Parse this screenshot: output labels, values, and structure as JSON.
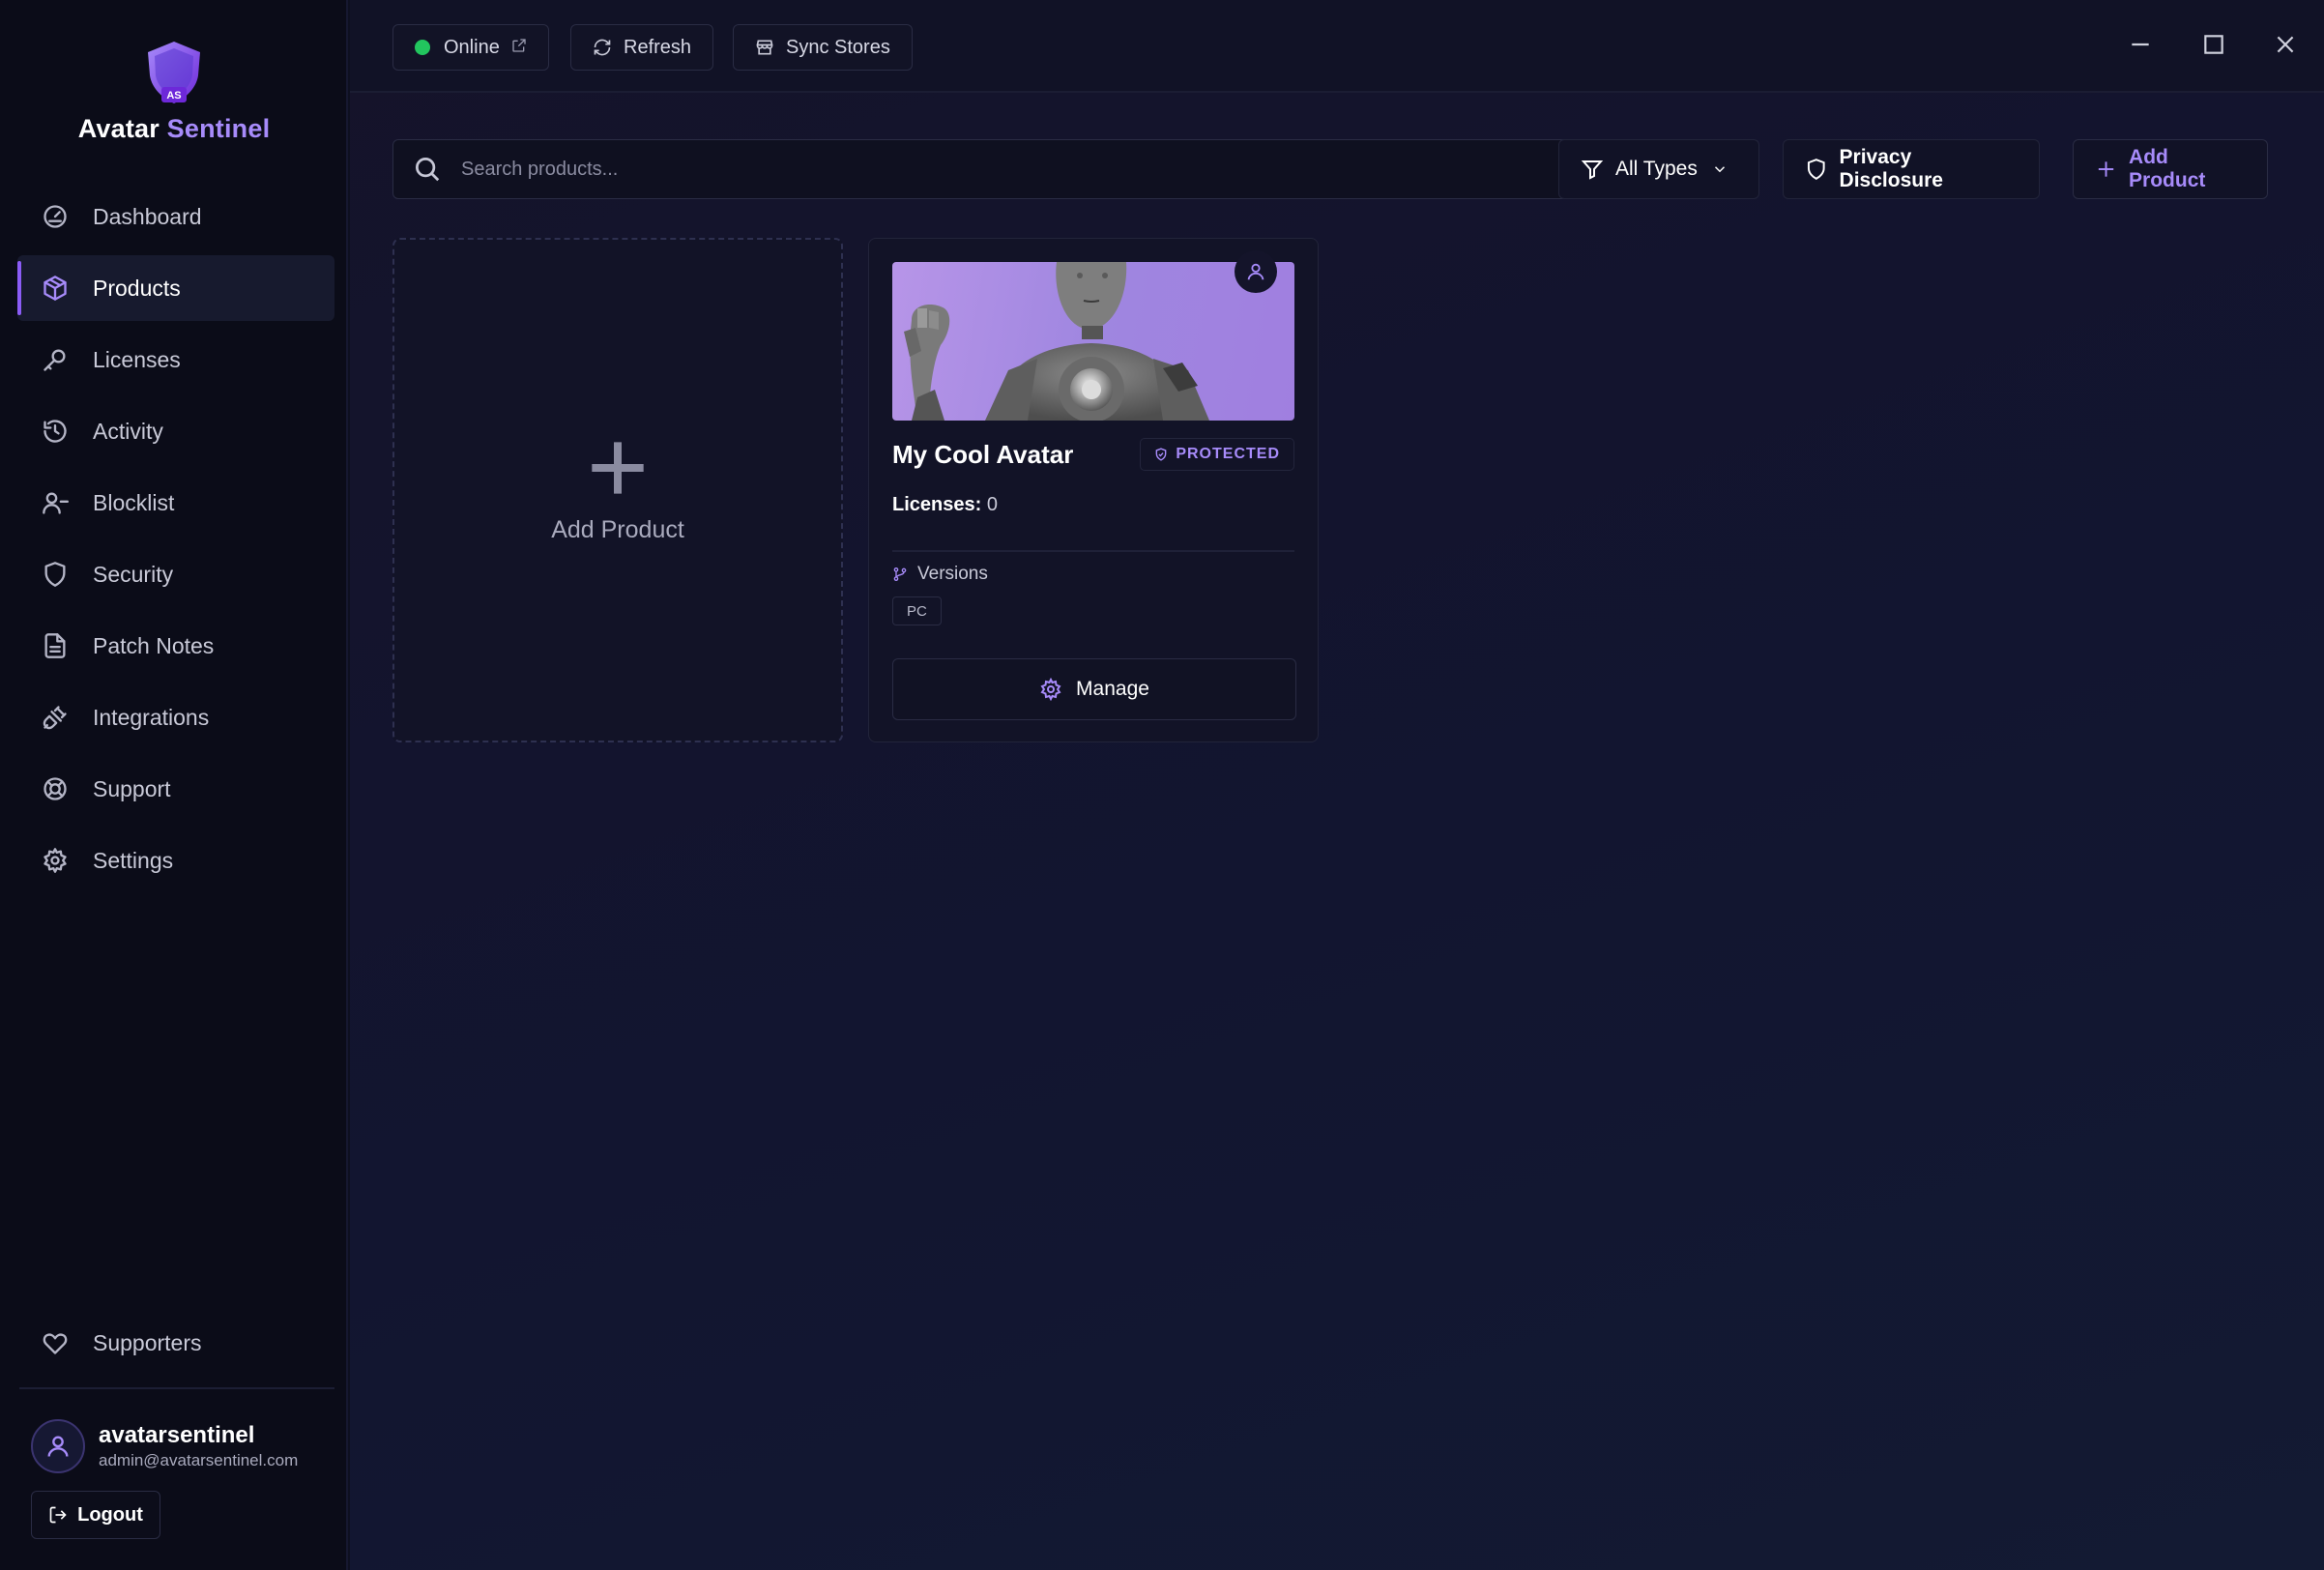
{
  "app": {
    "name_part1": "Avatar",
    "name_part2": "Sentinel",
    "logo_initials": "AS"
  },
  "sidebar": {
    "items": [
      {
        "label": "Dashboard",
        "icon": "gauge-icon",
        "active": false
      },
      {
        "label": "Products",
        "icon": "package-icon",
        "active": true
      },
      {
        "label": "Licenses",
        "icon": "key-icon",
        "active": false
      },
      {
        "label": "Activity",
        "icon": "history-icon",
        "active": false
      },
      {
        "label": "Blocklist",
        "icon": "user-minus-icon",
        "active": false
      },
      {
        "label": "Security",
        "icon": "shield-icon",
        "active": false
      },
      {
        "label": "Patch Notes",
        "icon": "file-text-icon",
        "active": false
      },
      {
        "label": "Integrations",
        "icon": "plug-icon",
        "active": false
      },
      {
        "label": "Support",
        "icon": "lifebuoy-icon",
        "active": false
      },
      {
        "label": "Settings",
        "icon": "gear-icon",
        "active": false
      }
    ],
    "supporters_label": "Supporters",
    "user": {
      "name": "avatarsentinel",
      "email": "admin@avatarsentinel.com"
    },
    "logout_label": "Logout"
  },
  "topbar": {
    "status_label": "Online",
    "refresh_label": "Refresh",
    "sync_label": "Sync Stores"
  },
  "toolbar": {
    "search_placeholder": "Search products...",
    "filter_label": "All Types",
    "privacy_label": "Privacy Disclosure",
    "add_product_label": "Add Product"
  },
  "products": {
    "add_card_label": "Add Product",
    "items": [
      {
        "name": "My Cool Avatar",
        "status": "PROTECTED",
        "licenses_label": "Licenses:",
        "licenses_count": "0",
        "versions_label": "Versions",
        "versions": [
          "PC"
        ],
        "manage_label": "Manage"
      }
    ]
  },
  "colors": {
    "accent": "#8b5cf6",
    "accent_light": "#a78bfa",
    "online": "#22c55e",
    "background": "#0e1020"
  }
}
